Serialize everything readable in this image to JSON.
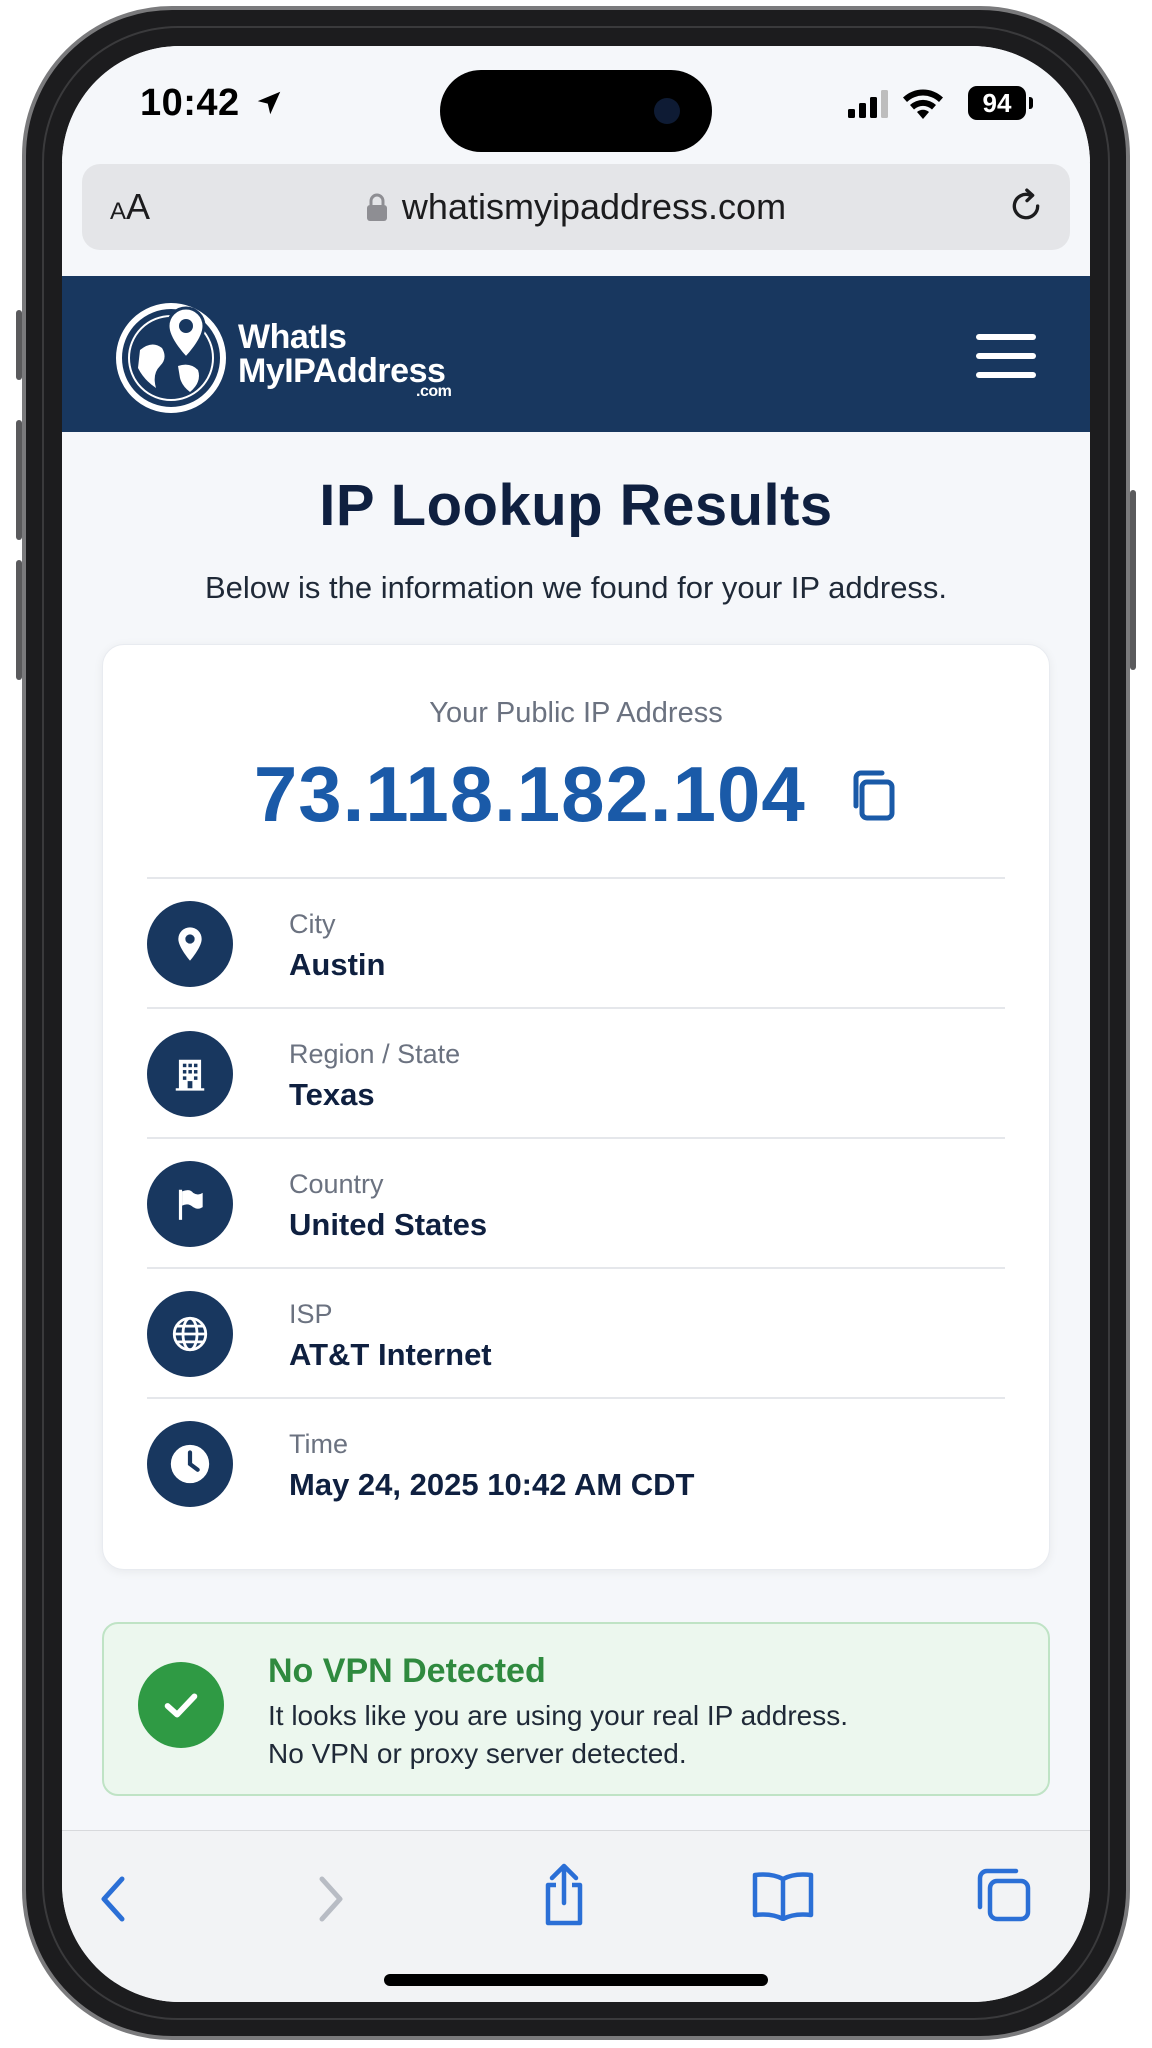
{
  "status_bar": {
    "time": "10:42",
    "battery": "94",
    "icons": [
      "location-arrow-icon",
      "cellular-signal-icon",
      "wifi-icon",
      "battery-icon"
    ]
  },
  "browser": {
    "text_size_label": "AA",
    "url": "whatismyipaddress.com",
    "icons": [
      "lock-icon",
      "reload-icon"
    ]
  },
  "site_header": {
    "logo_line1": "WhatIs",
    "logo_line2": "MyIPAddress",
    "logo_suffix": ".com",
    "menu_icon": "hamburger-menu-icon"
  },
  "main": {
    "title": "IP Lookup Results",
    "subtitle": "Below is the information we found for your IP address."
  },
  "ip_card": {
    "label": "Your Public IP Address",
    "ip": "73.118.182.104",
    "copy_icon": "copy-icon",
    "details": [
      {
        "label": "City",
        "value": "Austin",
        "icon": "map-pin-icon"
      },
      {
        "label": "Region / State",
        "value": "Texas",
        "icon": "building-icon"
      },
      {
        "label": "Country",
        "value": "United States",
        "icon": "flag-icon"
      },
      {
        "label": "ISP",
        "value": "AT&T Internet",
        "icon": "globe-icon"
      },
      {
        "label": "Time",
        "value": "May 24, 2025 10:42 AM CDT",
        "icon": "clock-icon"
      }
    ]
  },
  "vpn_status": {
    "title": "No VPN Detected",
    "line1": "It looks like you are using your real IP address.",
    "line2": "No VPN or proxy server detected.",
    "icon": "checkmark-icon"
  },
  "toolbar": {
    "icons": [
      "back-chevron-icon",
      "forward-chevron-icon",
      "share-icon",
      "bookmarks-icon",
      "tabs-icon"
    ]
  },
  "colors": {
    "header_navy": "#18375f",
    "ip_blue": "#1a5aa8",
    "success_green": "#2f9a44",
    "safari_blue": "#2b6fd6"
  }
}
